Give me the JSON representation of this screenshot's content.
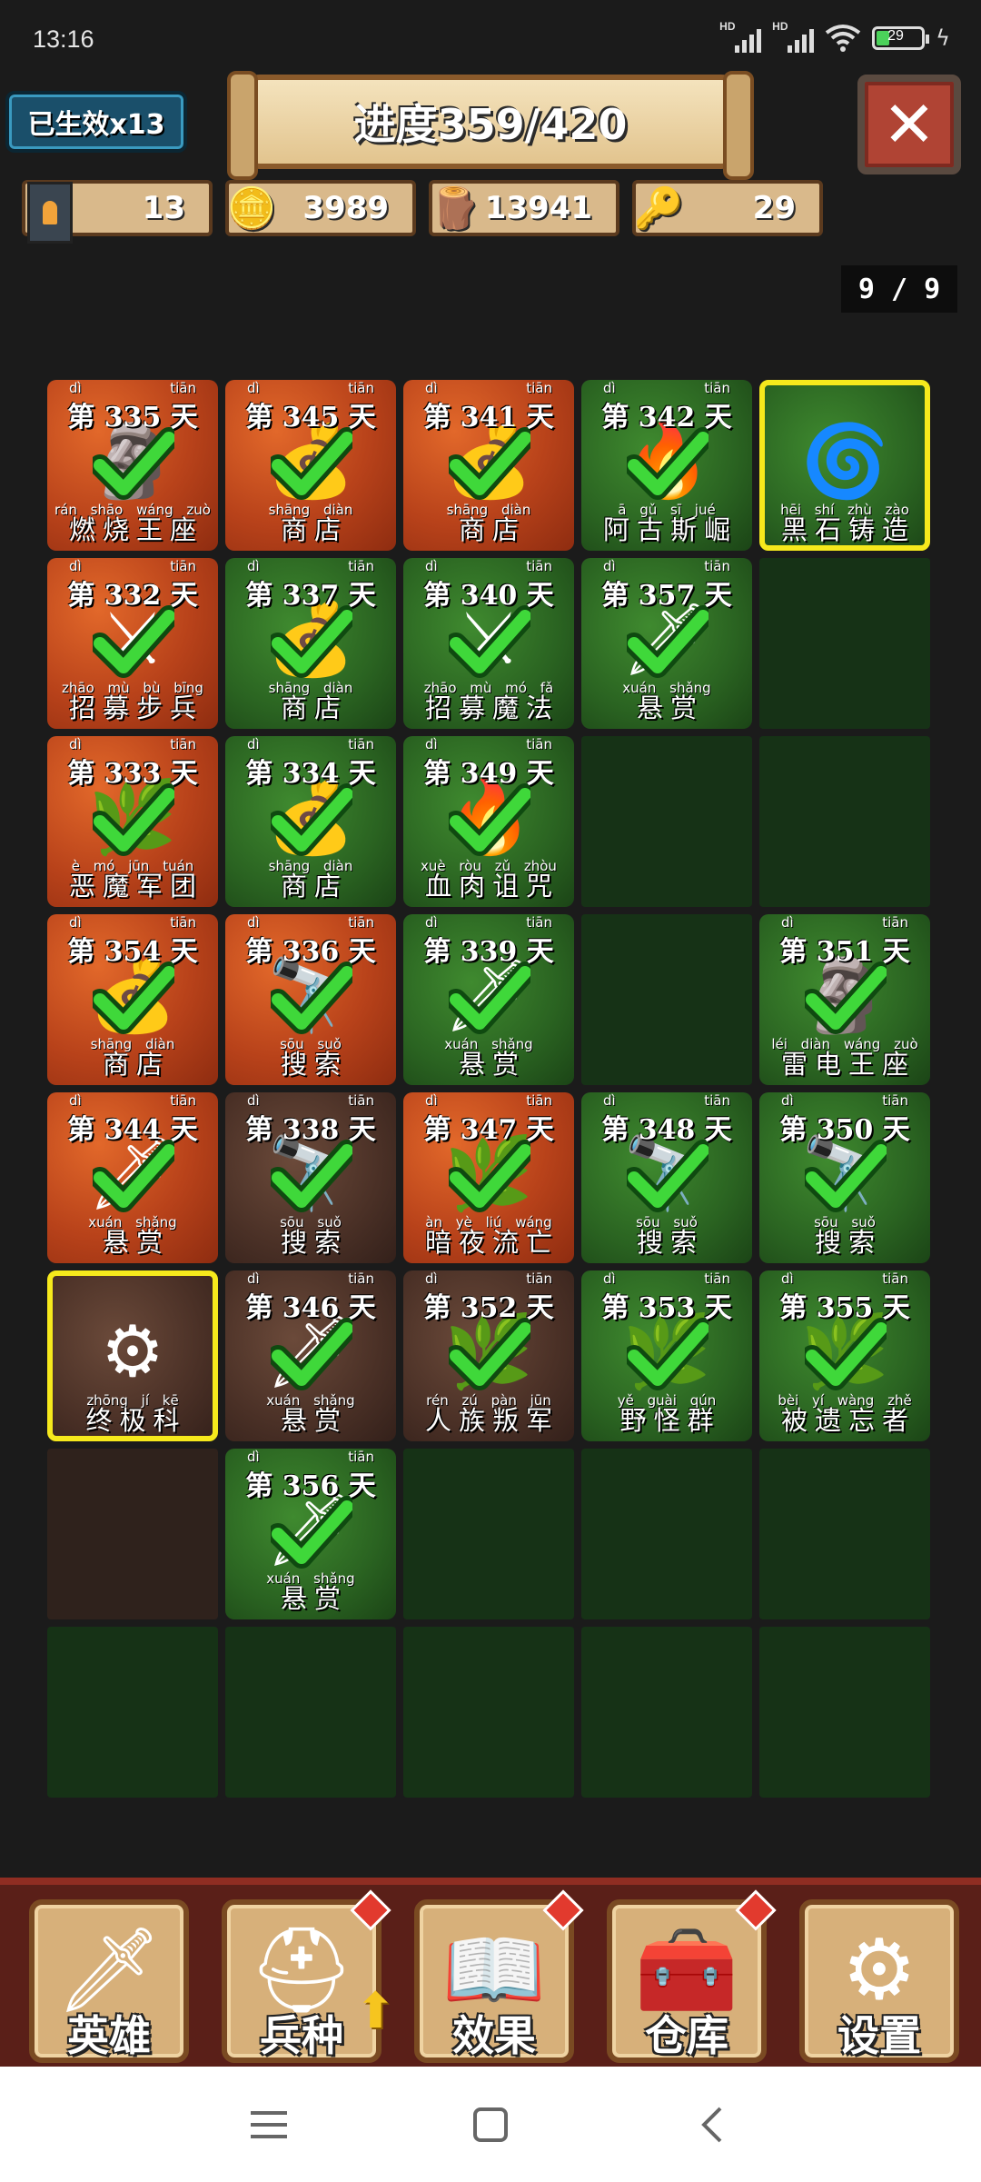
{
  "status": {
    "time": "13:16",
    "hd1": "HD",
    "hd2": "HD",
    "battery": "29"
  },
  "header": {
    "alive_count": "已生效x13",
    "progress": "进度359/420",
    "close_label": "✕"
  },
  "resources": [
    {
      "icon": "banner-soldier-icon",
      "value": "13"
    },
    {
      "icon": "gold-coins-icon",
      "value": "3989"
    },
    {
      "icon": "wood-logs-icon",
      "value": "13941"
    },
    {
      "icon": "crystal-key-icon",
      "value": "29"
    }
  ],
  "page_indicator": "9 / 9",
  "tiles": [
    {
      "row": 0,
      "col": 0,
      "bg": "lava",
      "art": "🗿",
      "day": "第 335 天",
      "day_py": [
        "dì",
        "tiān"
      ],
      "name": "燃烧王座",
      "name_py": "rán shāo wáng zuò",
      "done": true
    },
    {
      "row": 0,
      "col": 1,
      "bg": "lava",
      "art": "💰",
      "day": "第 345 天",
      "day_py": [
        "dì",
        "tiān"
      ],
      "name": "商店",
      "name_py": "shāng diàn",
      "done": true
    },
    {
      "row": 0,
      "col": 2,
      "bg": "lava",
      "art": "💰",
      "day": "第 341 天",
      "day_py": [
        "dì",
        "tiān"
      ],
      "name": "商店",
      "name_py": "shāng diàn",
      "done": true
    },
    {
      "row": 0,
      "col": 3,
      "bg": "forest",
      "art": "🔥",
      "day": "第 342 天",
      "day_py": [
        "dì",
        "tiān"
      ],
      "name": "阿古斯崛",
      "name_py": "ā gǔ sī jué",
      "done": true
    },
    {
      "row": 0,
      "col": 4,
      "bg": "forest",
      "art": "🌀",
      "day": "",
      "day_py": [],
      "name": "黑石铸造",
      "name_py": "hēi shí zhù zào",
      "done": false,
      "selected": true
    },
    {
      "row": 1,
      "col": 0,
      "bg": "lava",
      "art": "⚔",
      "day": "第 332 天",
      "day_py": [
        "dì",
        "tiān"
      ],
      "name": "招募步兵",
      "name_py": "zhāo mù bù bīng",
      "done": true
    },
    {
      "row": 1,
      "col": 1,
      "bg": "forest",
      "art": "💰",
      "day": "第 337 天",
      "day_py": [
        "dì",
        "tiān"
      ],
      "name": "商店",
      "name_py": "shāng diàn",
      "done": true
    },
    {
      "row": 1,
      "col": 2,
      "bg": "forest",
      "art": "⚔",
      "day": "第 340 天",
      "day_py": [
        "dì",
        "tiān"
      ],
      "name": "招募魔法",
      "name_py": "zhāo mù mó fǎ",
      "done": true
    },
    {
      "row": 1,
      "col": 3,
      "bg": "forest",
      "art": "🗡",
      "day": "第 357 天",
      "day_py": [
        "dì",
        "tiān"
      ],
      "name": "悬赏",
      "name_py": "xuán shǎng",
      "done": true
    },
    {
      "row": 1,
      "col": 4,
      "bg": "empty"
    },
    {
      "row": 2,
      "col": 0,
      "bg": "lava",
      "art": "🌿",
      "day": "第 333 天",
      "day_py": [
        "dì",
        "tiān"
      ],
      "name": "恶魔军团",
      "name_py": "è mó jūn tuán",
      "done": true
    },
    {
      "row": 2,
      "col": 1,
      "bg": "forest",
      "art": "💰",
      "day": "第 334 天",
      "day_py": [
        "dì",
        "tiān"
      ],
      "name": "商店",
      "name_py": "shāng diàn",
      "done": true
    },
    {
      "row": 2,
      "col": 2,
      "bg": "forest",
      "art": "🔥",
      "day": "第 349 天",
      "day_py": [
        "dì",
        "tiān"
      ],
      "name": "血肉诅咒",
      "name_py": "xuè ròu zǔ zhòu",
      "done": true
    },
    {
      "row": 2,
      "col": 3,
      "bg": "empty"
    },
    {
      "row": 2,
      "col": 4,
      "bg": "empty"
    },
    {
      "row": 3,
      "col": 0,
      "bg": "lava",
      "art": "💰",
      "day": "第 354 天",
      "day_py": [
        "dì",
        "tiān"
      ],
      "name": "商店",
      "name_py": "shāng diàn",
      "done": true
    },
    {
      "row": 3,
      "col": 1,
      "bg": "lava",
      "art": "🔭",
      "day": "第 336 天",
      "day_py": [
        "dì",
        "tiān"
      ],
      "name": "搜索",
      "name_py": "sōu suǒ",
      "done": true
    },
    {
      "row": 3,
      "col": 2,
      "bg": "forest",
      "art": "🗡",
      "day": "第 339 天",
      "day_py": [
        "dì",
        "tiān"
      ],
      "name": "悬赏",
      "name_py": "xuán shǎng",
      "done": true
    },
    {
      "row": 3,
      "col": 3,
      "bg": "empty"
    },
    {
      "row": 3,
      "col": 4,
      "bg": "forest",
      "art": "🗿",
      "day": "第 351 天",
      "day_py": [
        "dì",
        "tiān"
      ],
      "name": "雷电王座",
      "name_py": "léi diàn wáng zuò",
      "done": true
    },
    {
      "row": 4,
      "col": 0,
      "bg": "lava",
      "art": "🗡",
      "day": "第 344 天",
      "day_py": [
        "dì",
        "tiān"
      ],
      "name": "悬赏",
      "name_py": "xuán shǎng",
      "done": true
    },
    {
      "row": 4,
      "col": 1,
      "bg": "dirt",
      "art": "🔭",
      "day": "第 338 天",
      "day_py": [
        "dì",
        "tiān"
      ],
      "name": "搜索",
      "name_py": "sōu suǒ",
      "done": true
    },
    {
      "row": 4,
      "col": 2,
      "bg": "lava",
      "art": "🌿",
      "day": "第 347 天",
      "day_py": [
        "dì",
        "tiān"
      ],
      "name": "暗夜流亡",
      "name_py": "àn yè liú wáng",
      "done": true
    },
    {
      "row": 4,
      "col": 3,
      "bg": "forest",
      "art": "🔭",
      "day": "第 348 天",
      "day_py": [
        "dì",
        "tiān"
      ],
      "name": "搜索",
      "name_py": "sōu suǒ",
      "done": true
    },
    {
      "row": 4,
      "col": 4,
      "bg": "forest",
      "art": "🔭",
      "day": "第 350 天",
      "day_py": [
        "dì",
        "tiān"
      ],
      "name": "搜索",
      "name_py": "sōu suǒ",
      "done": true
    },
    {
      "row": 5,
      "col": 0,
      "bg": "dirt",
      "art": "⚙",
      "day": "",
      "day_py": [],
      "name": "终极科",
      "name_py": "zhōng jí kē",
      "done": false,
      "selected": true
    },
    {
      "row": 5,
      "col": 1,
      "bg": "dirt",
      "art": "🗡",
      "day": "第 346 天",
      "day_py": [
        "dì",
        "tiān"
      ],
      "name": "悬赏",
      "name_py": "xuán shǎng",
      "done": true
    },
    {
      "row": 5,
      "col": 2,
      "bg": "dirt",
      "art": "🌿",
      "day": "第 352 天",
      "day_py": [
        "dì",
        "tiān"
      ],
      "name": "人族叛军",
      "name_py": "rén zú pàn jūn",
      "done": true
    },
    {
      "row": 5,
      "col": 3,
      "bg": "forest",
      "art": "🌿",
      "day": "第 353 天",
      "day_py": [
        "dì",
        "tiān"
      ],
      "name": "野怪群",
      "name_py": "yě guài qún",
      "done": true
    },
    {
      "row": 5,
      "col": 4,
      "bg": "forest",
      "art": "🌿",
      "day": "第 355 天",
      "day_py": [
        "dì",
        "tiān"
      ],
      "name": "被遗忘者",
      "name_py": "bèi yí wàng zhě",
      "done": true
    },
    {
      "row": 6,
      "col": 0,
      "bg": "empty-dirt"
    },
    {
      "row": 6,
      "col": 1,
      "bg": "forest",
      "art": "🗡",
      "day": "第 356 天",
      "day_py": [
        "dì",
        "tiān"
      ],
      "name": "悬赏",
      "name_py": "xuán shǎng",
      "done": true
    },
    {
      "row": 6,
      "col": 2,
      "bg": "empty"
    },
    {
      "row": 6,
      "col": 3,
      "bg": "empty"
    },
    {
      "row": 6,
      "col": 4,
      "bg": "empty"
    },
    {
      "row": 7,
      "col": 0,
      "bg": "empty"
    },
    {
      "row": 7,
      "col": 1,
      "bg": "empty"
    },
    {
      "row": 7,
      "col": 2,
      "bg": "empty"
    },
    {
      "row": 7,
      "col": 3,
      "bg": "empty"
    },
    {
      "row": 7,
      "col": 4,
      "bg": "empty"
    }
  ],
  "bottom_nav": [
    {
      "key": "heroes",
      "label": "英雄",
      "icon": "sword-icon",
      "glyph": "🗡",
      "badge": false,
      "upgrade": false
    },
    {
      "key": "troops",
      "label": "兵种",
      "icon": "knight-helmet-icon",
      "glyph": "⛑",
      "badge": true,
      "upgrade": true
    },
    {
      "key": "effects",
      "label": "效果",
      "icon": "spell-book-icon",
      "glyph": "📖",
      "badge": true,
      "upgrade": false
    },
    {
      "key": "warehouse",
      "label": "仓库",
      "icon": "treasure-chest-icon",
      "glyph": "🧰",
      "badge": true,
      "upgrade": false
    },
    {
      "key": "settings",
      "label": "设置",
      "icon": "gear-icon",
      "glyph": "⚙",
      "badge": false,
      "upgrade": false
    }
  ],
  "colors": {
    "selected_outline": "#f6e91c",
    "check_green": "#3fd83a",
    "bottom_bar": "#5a1f18"
  }
}
